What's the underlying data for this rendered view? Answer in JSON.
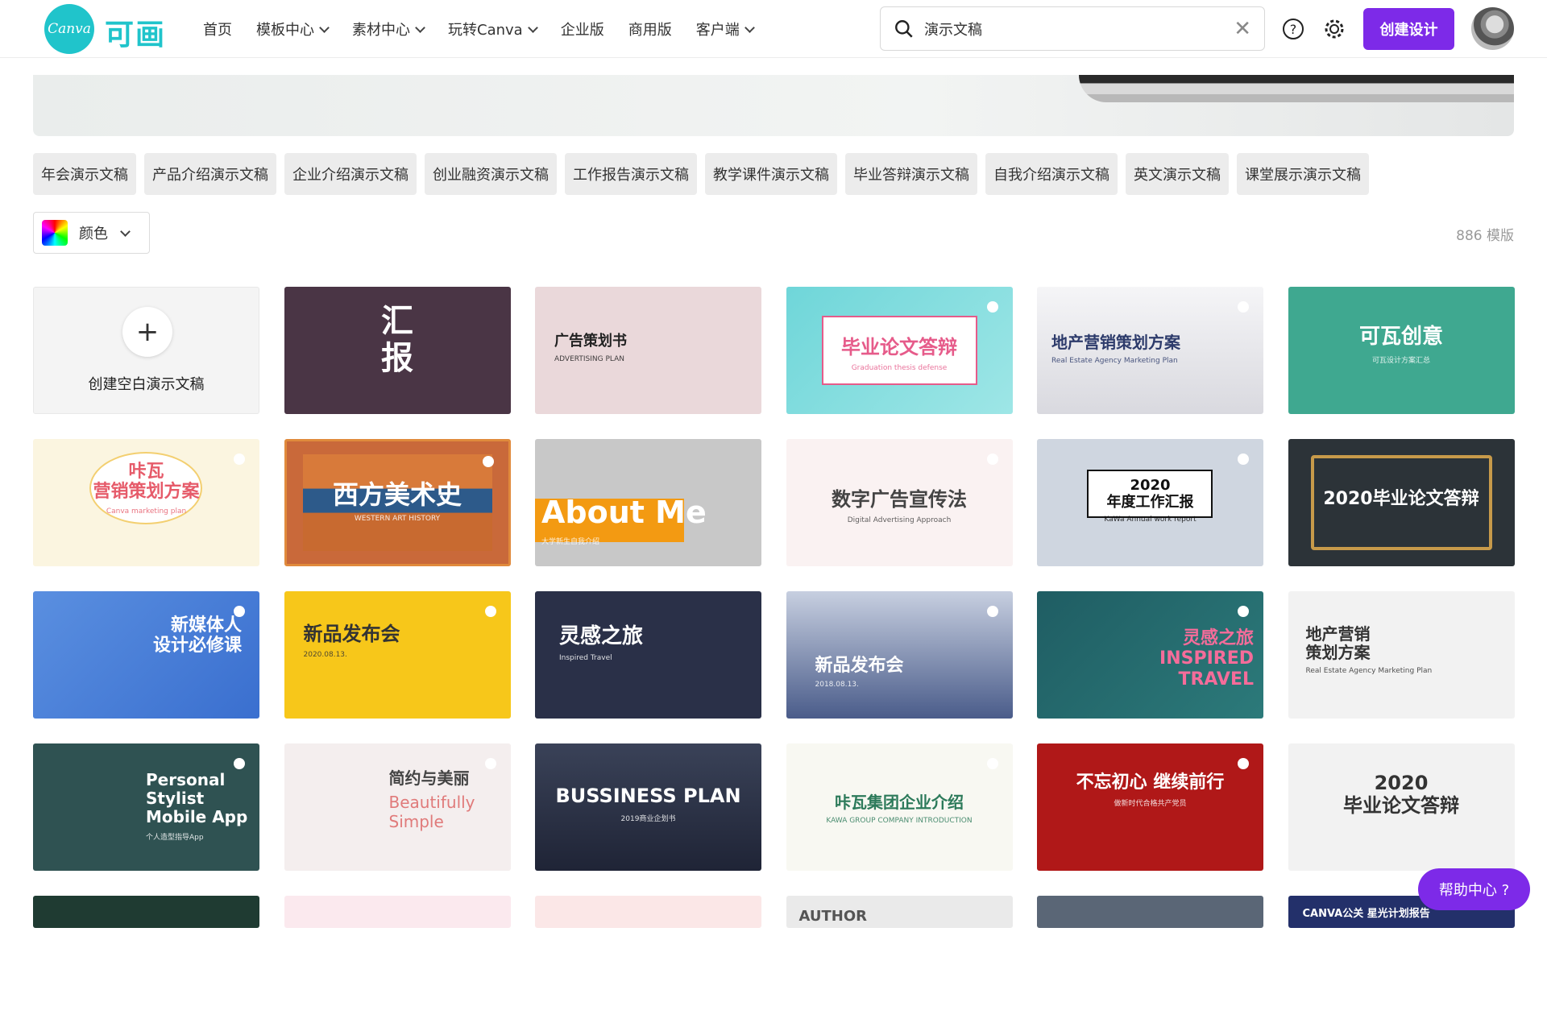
{
  "header": {
    "logo_text": "Canva",
    "brand_text": "可画",
    "nav": [
      {
        "label": "首页",
        "dropdown": false
      },
      {
        "label": "模板中心",
        "dropdown": true
      },
      {
        "label": "素材中心",
        "dropdown": true
      },
      {
        "label": "玩转Canva",
        "dropdown": true
      },
      {
        "label": "企业版",
        "dropdown": false
      },
      {
        "label": "商用版",
        "dropdown": false
      },
      {
        "label": "客户端",
        "dropdown": true
      }
    ],
    "search_value": "演示文稿",
    "create_label": "创建设计",
    "accent": "#7d2ae8"
  },
  "chips": [
    "年会演示文稿",
    "产品介绍演示文稿",
    "企业介绍演示文稿",
    "创业融资演示文稿",
    "工作报告演示文稿",
    "教学课件演示文稿",
    "毕业答辩演示文稿",
    "自我介绍演示文稿",
    "英文演示文稿",
    "课堂展示演示文稿"
  ],
  "filter": {
    "color_label": "颜色",
    "count": "886 模版"
  },
  "blank_card": {
    "label": "创建空白演示文稿"
  },
  "cards": [
    {
      "title": "汇\n报"
    },
    {
      "title": "广告策划书",
      "sub": "ADVERTISING PLAN"
    },
    {
      "title": "毕业论文答辩",
      "sub": "Graduation thesis defense"
    },
    {
      "title": "地产营销策划方案",
      "sub": "Real Estate Agency Marketing Plan"
    },
    {
      "title": "可瓦创意",
      "sub": "可瓦设计方案汇总"
    },
    {
      "title": "咔瓦\n营销策划方案",
      "sub": "Canva marketing plan"
    },
    {
      "title": "西方美术史",
      "sub": "WESTERN ART HISTORY"
    },
    {
      "title": "About Me",
      "sub": "大学新生自我介绍"
    },
    {
      "title": "数字广告宣传法",
      "sub": "Digital Advertising Approach"
    },
    {
      "title": "2020\n年度工作汇报",
      "sub": "KaWa Annual work report"
    },
    {
      "title": "2020毕业论文答辩"
    },
    {
      "title": "新媒体人\n设计必修课"
    },
    {
      "title": "新品发布会",
      "sub": "2020.08.13."
    },
    {
      "title": "灵感之旅",
      "sub": "Inspired Travel"
    },
    {
      "title": "新品发布会",
      "sub": "2018.08.13."
    },
    {
      "title": "灵感之旅\nINSPIRED\nTRAVEL"
    },
    {
      "title": "地产营销\n策划方案",
      "sub": "Real Estate Agency Marketing Plan"
    },
    {
      "title": "Personal\nStylist\nMobile App",
      "sub": "个人造型指导App"
    },
    {
      "title": "简约与美丽",
      "sub": "Beautifully\nSimple"
    },
    {
      "title": "BUSSINESS PLAN",
      "sub": "2019商业企划书"
    },
    {
      "title": "咔瓦集团企业介绍",
      "sub": "KAWA GROUP COMPANY INTRODUCTION"
    },
    {
      "title": "不忘初心  继续前行",
      "sub": "做新时代合格共产党员"
    },
    {
      "title": "2020\n毕业论文答辩"
    },
    {
      "title": ""
    },
    {
      "title": ""
    },
    {
      "title": ""
    },
    {
      "title": "AUTHOR"
    },
    {
      "title": ""
    },
    {
      "title": "CANVA公关  星光计划报告"
    }
  ],
  "help_label": "帮助中心  ?"
}
